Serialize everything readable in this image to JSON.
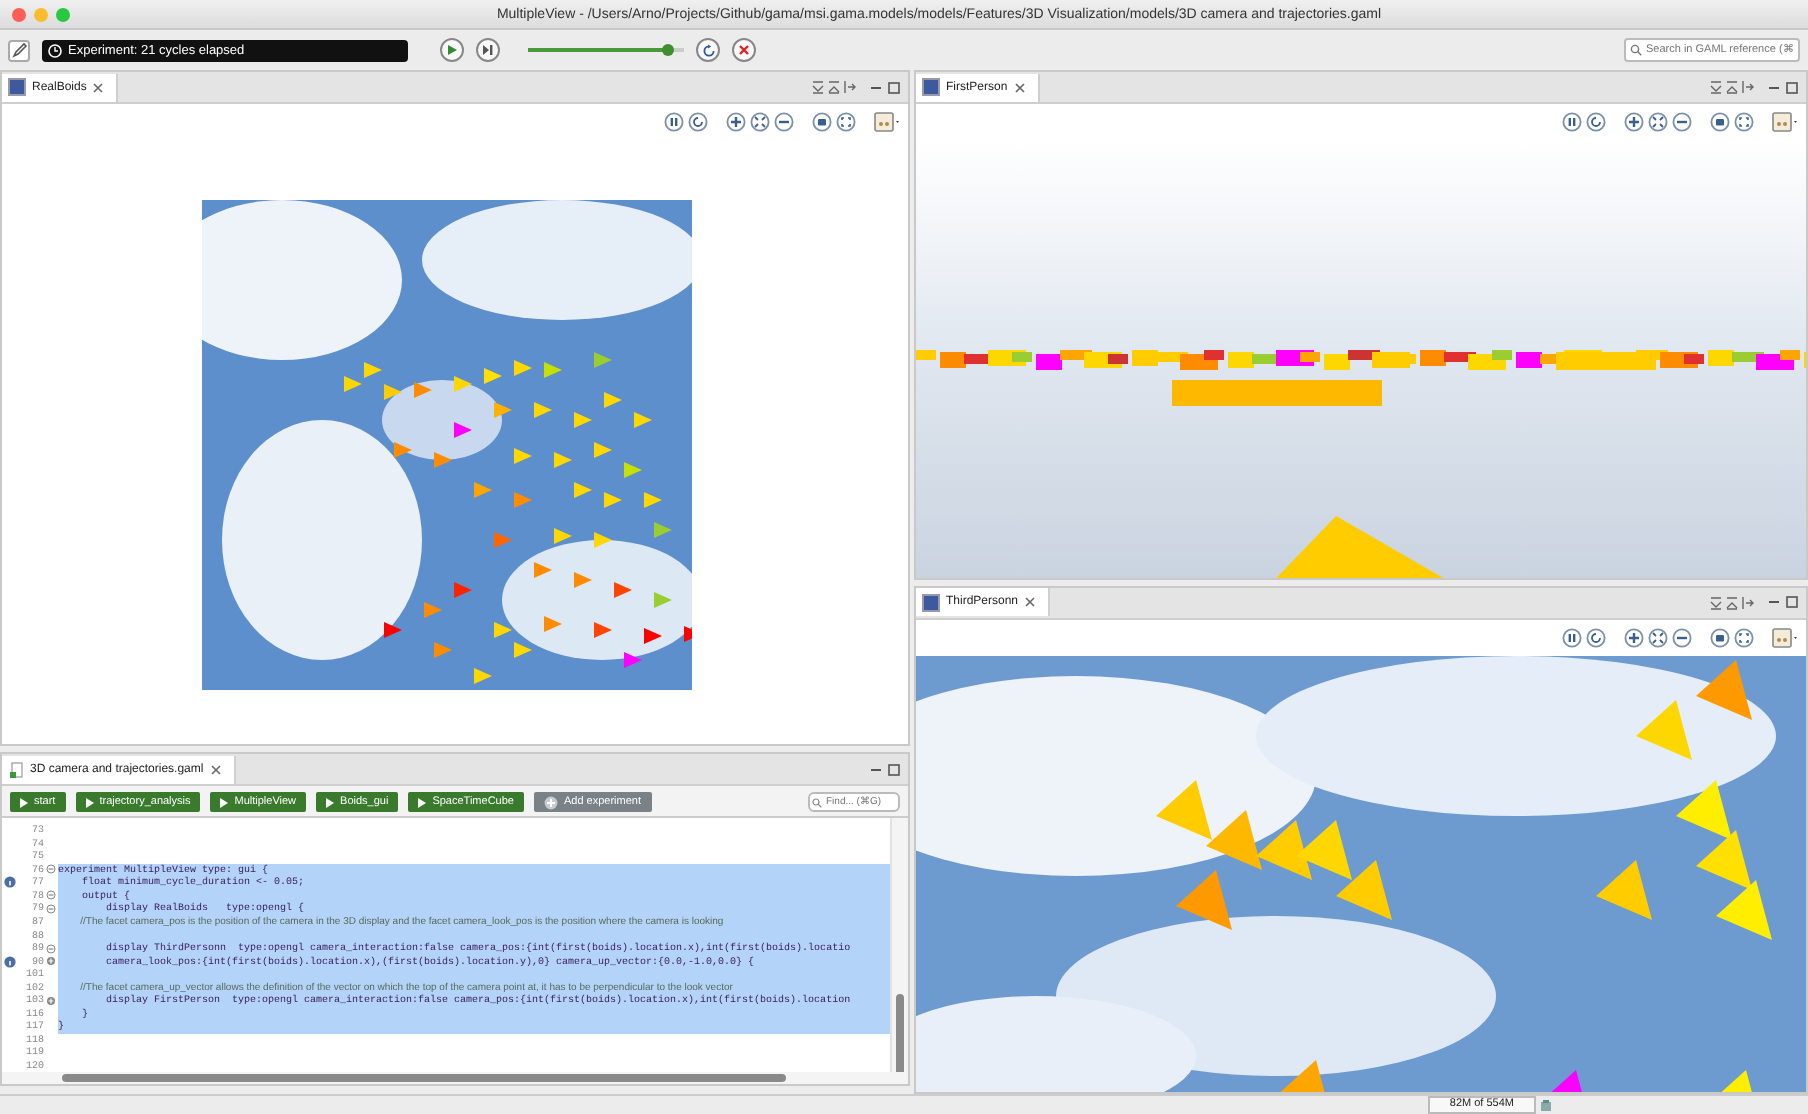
{
  "window": {
    "title": "MultipleView - /Users/Arno/Projects/Github/gama/msi.gama.models/models/Features/3D Visualization/models/3D camera and trajectories.gaml"
  },
  "toolbar": {
    "experiment_status": "Experiment: 21 cycles elapsed",
    "speed": {
      "level": 0.9
    },
    "search": {
      "placeholder": "Search in GAML reference (⌘"
    }
  },
  "views": [
    {
      "title": "RealBoids",
      "kind": "boids_sky"
    },
    {
      "title": "FirstPerson",
      "kind": "first_person"
    },
    {
      "title": "ThirdPersonn",
      "kind": "third_person"
    }
  ],
  "editor": {
    "tab": "3D camera and trajectories.gaml",
    "find": {
      "placeholder": "Find... (⌘G)"
    },
    "experiments": [
      {
        "label": "start",
        "kind": "run"
      },
      {
        "label": "trajectory_analysis",
        "kind": "run"
      },
      {
        "label": "MultipleView",
        "kind": "run"
      },
      {
        "label": "Boids_gui",
        "kind": "run"
      },
      {
        "label": "SpaceTimeCube",
        "kind": "run"
      },
      {
        "label": "Add experiment",
        "kind": "add"
      }
    ],
    "lines": [
      {
        "number": "73",
        "selected": false
      },
      {
        "number": "74",
        "selected": false
      },
      {
        "number": "75",
        "selected": false
      },
      {
        "number": "76",
        "text": "experiment MultipleView type: gui {",
        "kind": "code",
        "selected": true,
        "folded": false
      },
      {
        "number": "77",
        "text": "    float minimum_cycle_duration <- 0.05;",
        "kind": "code",
        "selected": true,
        "info": true
      },
      {
        "number": "78",
        "text": "    output {",
        "kind": "code",
        "selected": true,
        "folded": false
      },
      {
        "number": "79",
        "text": "        display RealBoids   type:opengl {",
        "kind": "code",
        "selected": true,
        "folded": false
      },
      {
        "number": "87",
        "text": "        //The facet camera_pos is the position of the camera in the 3D display and the facet camera_look_pos is the position where the camera is looking",
        "kind": "comment",
        "selected": true
      },
      {
        "number": "88",
        "selected": true
      },
      {
        "number": "89",
        "text": "        display ThirdPersonn  type:opengl camera_interaction:false camera_pos:{int(first(boids).location.x),int(first(boids).locatio",
        "kind": "code",
        "selected": true,
        "folded": false
      },
      {
        "number": "90",
        "text": "        camera_look_pos:{int(first(boids).location.x),(first(boids).location.y),0} camera_up_vector:{0.0,-1.0,0.0} {",
        "kind": "code",
        "selected": true,
        "folded": true,
        "info": true
      },
      {
        "number": "101",
        "selected": true
      },
      {
        "number": "102",
        "text": "        //The facet camera_up_vector allows the definition of the vector on which the top of the camera point at, it has to be perpendicular to the look vector",
        "kind": "comment",
        "selected": true
      },
      {
        "number": "103",
        "text": "        display FirstPerson  type:opengl camera_interaction:false camera_pos:{int(first(boids).location.x),int(first(boids).location",
        "kind": "code",
        "selected": true,
        "folded": true
      },
      {
        "number": "116",
        "text": "    }",
        "kind": "code",
        "selected": true
      },
      {
        "number": "117",
        "text": "}",
        "kind": "code",
        "selected": true
      },
      {
        "number": "118",
        "selected": false
      },
      {
        "number": "119",
        "selected": false
      },
      {
        "number": "120",
        "selected": false
      }
    ]
  },
  "status_bar": {
    "memory": "82M of 554M"
  }
}
